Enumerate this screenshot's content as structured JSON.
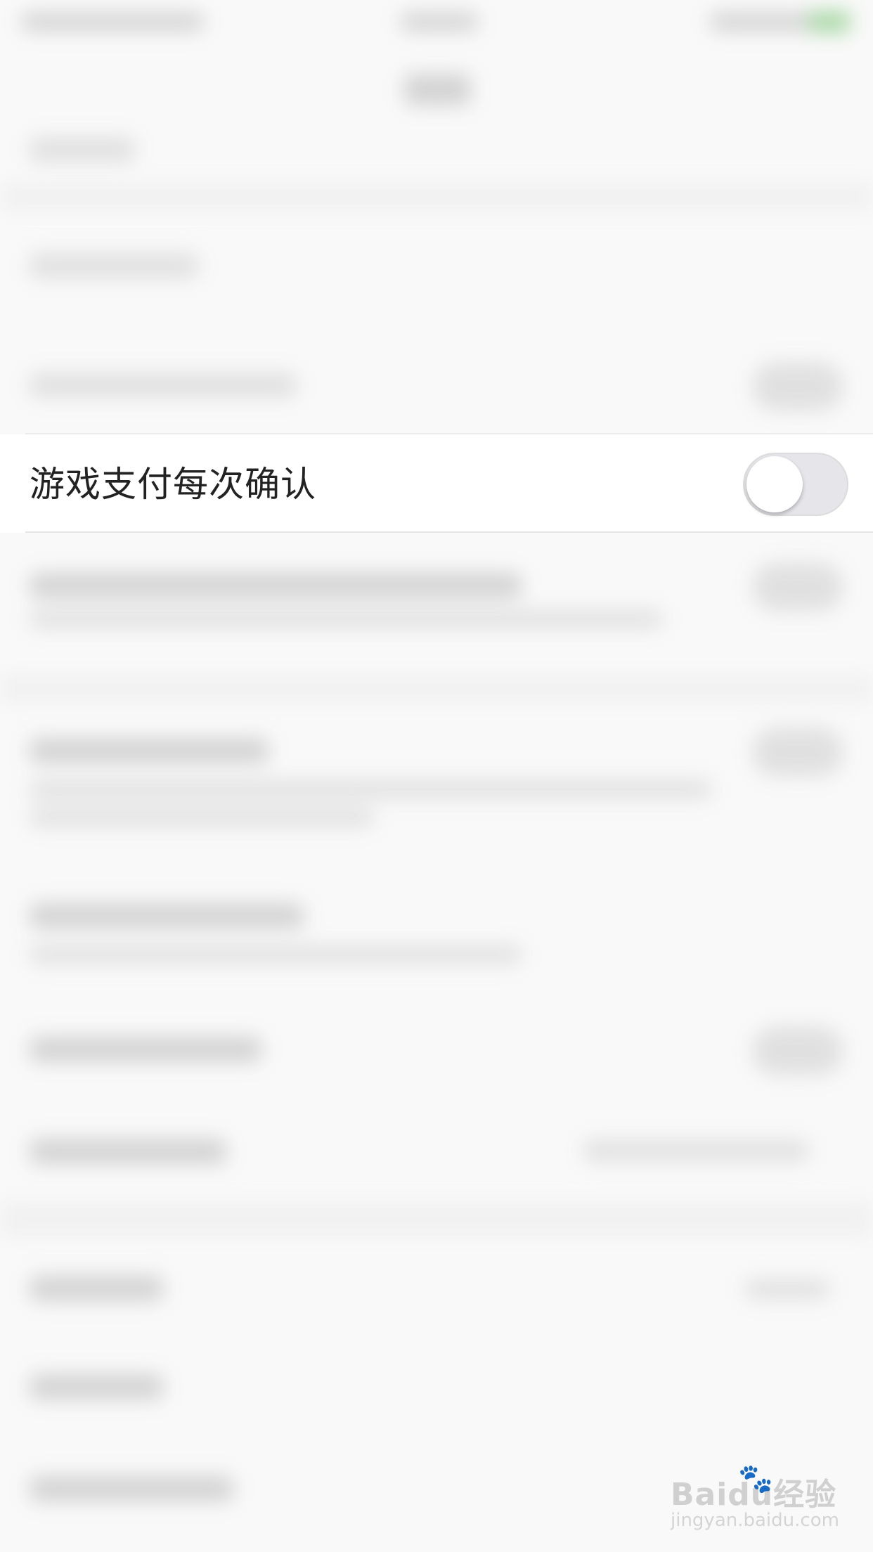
{
  "settings": {
    "game_payment_confirm": {
      "label": "游戏支付每次确认",
      "toggle_on": false
    }
  },
  "watermark": {
    "logo": "Baidu经验",
    "url": "jingyan.baidu.com"
  },
  "colors": {
    "toggle_off_track": "#e5e5ea",
    "toggle_knob": "#ffffff",
    "label_text": "#222222",
    "status_green": "#4cd964"
  }
}
